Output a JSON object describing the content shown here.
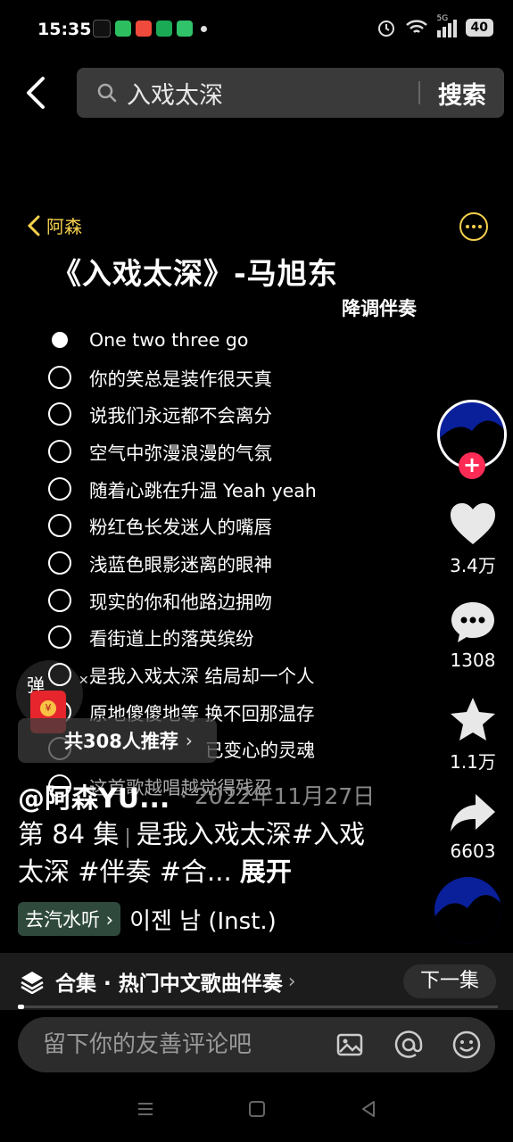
{
  "status_bar": {
    "time": "15:35",
    "network": "5G",
    "battery": "40"
  },
  "search": {
    "query": "入戏太深",
    "button": "搜索"
  },
  "video": {
    "author_back_label": "阿森",
    "song_title": "《入戏太深》-马旭东",
    "song_tag": "降调伴奏",
    "lyrics": [
      "One two three go",
      "你的笑总是装作很天真",
      "说我们永远都不会离分",
      "空气中弥漫浪漫的气氛",
      "随着心跳在升温 Yeah yeah",
      "粉红色长发迷人的嘴唇",
      "浅蓝色眼影迷离的眼神",
      "现实的你和他路边拥吻",
      "看街道上的落英缤纷",
      "是我入戏太深 结局却一个人",
      "原地傻傻地等 换不回那温存",
      "已变心的灵魂",
      "这首歌越唱越觉得残忍"
    ]
  },
  "rail": {
    "likes": "3.4万",
    "comments": "1308",
    "favorites": "1.1万",
    "shares": "6603"
  },
  "overlay": {
    "danmu_label": "弹",
    "recommend": "共308人推荐",
    "username": "@阿森YU...",
    "date": "· 2022年11月27日",
    "episode": "第 84 集",
    "caption_text": "是我入戏太深#入戏太深 #伴奏 #合...",
    "expand": "展开",
    "music_button": "去汽水听",
    "music_name": "이젠 남 (Inst.)"
  },
  "collection": {
    "label": "合集 · 热门中文歌曲伴奏",
    "next_button": "下一集"
  },
  "comment": {
    "placeholder": "留下你的友善评论吧"
  },
  "colors": {
    "accent_yellow": "#f6d04d",
    "follow_red": "#fe2c55",
    "background": "#000000"
  }
}
